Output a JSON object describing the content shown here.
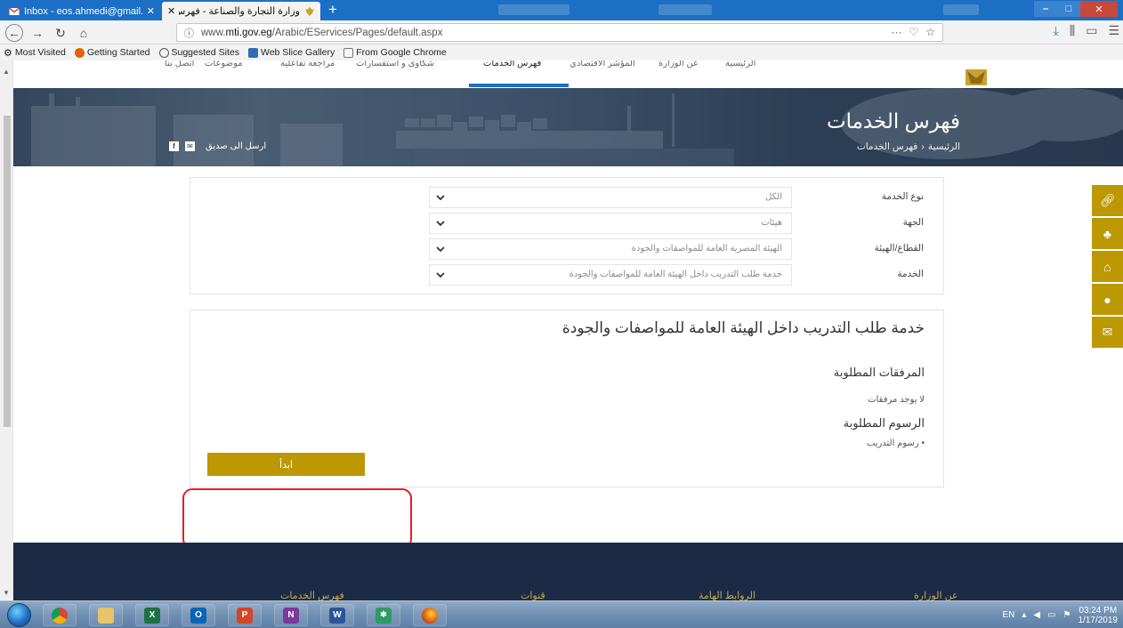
{
  "browser": {
    "tabs": [
      {
        "title": "Inbox - eos.ahmedi@gmail.co",
        "active": false
      },
      {
        "title": "وزارة التجارة والصناعة - فهرس الخ",
        "active": true
      }
    ],
    "new_tab_label": "+",
    "url_prefix": "www.",
    "url_domain": "mti.gov.eg",
    "url_path": "/Arabic/EServices/Pages/default.aspx",
    "url_actions": "···",
    "bookmarks": [
      {
        "label": "Most Visited",
        "icon": "gear-icon"
      },
      {
        "label": "Getting Started",
        "icon": "firefox-icon"
      },
      {
        "label": "Suggested Sites",
        "icon": "ie-icon"
      },
      {
        "label": "Web Slice Gallery",
        "icon": "web-slice-icon"
      },
      {
        "label": "From Google Chrome",
        "icon": "folder-icon"
      }
    ]
  },
  "site_nav": {
    "items": [
      "الرئيسية",
      "عن الوزارة",
      "المؤشر الاقتصادي",
      "فهرس الخدمات",
      "شكاوى و استفسارات",
      "مراجعة تفاعلية",
      "موضوعات",
      "اتصل بنا"
    ]
  },
  "hero": {
    "title": "فهرس الخدمات",
    "breadcrumb": [
      "الرئيسية",
      "فهرس الخدمات"
    ],
    "breadcrumb_sep": "‹",
    "share_label": "ارسل الى صديق"
  },
  "filters": [
    {
      "label": "نوع الخدمة",
      "value": "الكل"
    },
    {
      "label": "الجهة",
      "value": "هيئات"
    },
    {
      "label": "القطاع/الهيئة",
      "value": "الهيئة المصرية العامة للمواصفات والجودة"
    },
    {
      "label": "الخدمة",
      "value": "خدمة طلب التدريب داخل الهيئة العامة للمواصفات والجودة"
    }
  ],
  "service": {
    "title": "خدمة طلب التدريب داخل الهيئة العامة للمواصفات والجودة",
    "attachments_heading": "المرفقات المطلوبة",
    "attachments_text": "لا يوجد مرفقات",
    "fees_heading": "الرسوم المطلوبة",
    "fees_items": [
      "رسوم التدريب"
    ],
    "start_button": "ابدأ"
  },
  "footer": {
    "items": [
      "عن الوزارة",
      "الروابط الهامة",
      "قنوات",
      "فهرس الخدمات"
    ]
  },
  "taskbar": {
    "apps": [
      "chrome",
      "explorer",
      "excel",
      "outlook",
      "powerpoint",
      "onenote",
      "word",
      "sketch",
      "firefox"
    ],
    "language": "EN",
    "time": "03:24 PM",
    "date": "1/17/2019"
  },
  "colors": {
    "gold": "#bc9803",
    "navy": "#1b2b45",
    "highlight": "#e0202b",
    "tab_blue": "#1c6fc4"
  }
}
